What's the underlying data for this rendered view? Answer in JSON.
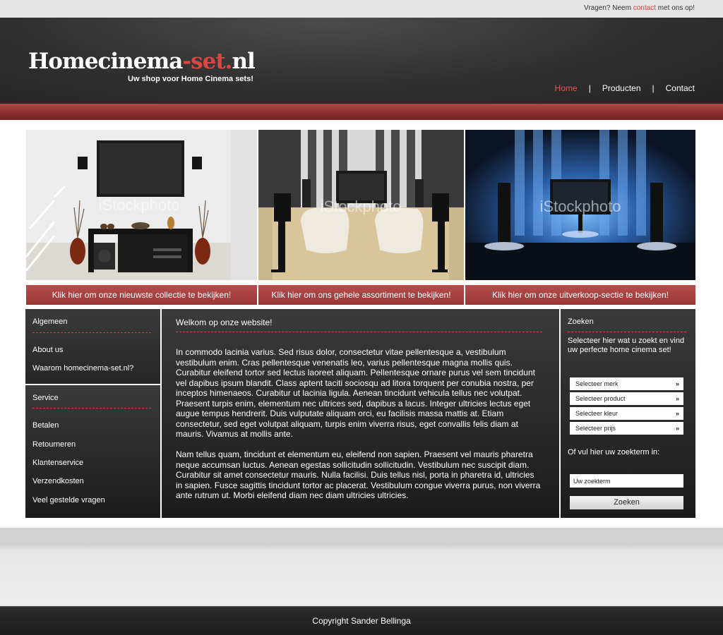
{
  "topbar": {
    "prefix": "Vragen? Neem ",
    "link": "contact",
    "suffix": " met ons op!"
  },
  "header": {
    "logo_part1": "Homecinema",
    "logo_part2": "-set.",
    "logo_part3": "nl",
    "tagline": "Uw shop voor Home Cinema sets!",
    "nav": [
      "Home",
      "Producten",
      "Contact"
    ],
    "nav_separator": "|"
  },
  "banners": [
    {
      "button": "Klik hier om onze nieuwste collectie te bekijken!",
      "watermark": "iStockphoto"
    },
    {
      "button": "Klik hier om ons gehele assortiment te bekijken!",
      "watermark": "iStockphoto"
    },
    {
      "button": "Klik hier om onze uitverkoop-sectie te bekijken!",
      "watermark": "iStockphoto"
    }
  ],
  "sidebar_left": {
    "general_title": "Algemeen",
    "general_links": [
      "About us",
      "Waarom homecinema-set.nl?"
    ],
    "service_title": "Service",
    "service_links": [
      "Betalen",
      "Retourneren",
      "Klantenservice",
      "Verzendkosten",
      "Veel gestelde vragen"
    ]
  },
  "main": {
    "title": "Welkom op onze website!",
    "paragraph1": "In commodo lacinia varius. Sed risus dolor, consectetur vitae pellentesque a, vestibulum vestibulum enim. Cras pellentesque venenatis leo, varius pellentesque magna mollis quis. Curabitur eleifend tortor sed lectus laoreet aliquam. Pellentesque ornare purus vel sem tincidunt vel dapibus ipsum blandit. Class aptent taciti sociosqu ad litora torquent per conubia nostra, per inceptos himenaeos. Curabitur ut lacinia ligula. Aenean tincidunt vehicula tellus nec volutpat. Praesent turpis enim, elementum nec ultrices sed, dapibus a lacus. Integer ultricies lectus eget augue tempus hendrerit. Duis vulputate aliquam orci, eu facilisis massa mattis at. Etiam consectetur, sed eget volutpat aliquam, turpis enim viverra risus, eget convallis felis diam at mauris. Vivamus at mollis ante.",
    "paragraph2": "Nam tellus quam, tincidunt et elementum eu, eleifend non sapien. Praesent vel mauris pharetra neque accumsan luctus. Aenean egestas sollicitudin sollicitudin. Vestibulum nec suscipit diam. Curabitur sit amet consectetur mauris. Nulla facilisi. Duis tellus nisl, porta in pharetra id, ultricies in sapien. Fusce sagittis tincidunt tortor ac placerat. Vestibulum congue viverra purus, non viverra ante rutrum ut. Morbi eleifend diam nec diam ultricies ultricies."
  },
  "sidebar_right": {
    "title": "Zoeken",
    "intro": "Selecteer hier wat u zoekt en vind uw perfecte home cinema set!",
    "selects": [
      "Selecteer merk",
      "Selecteer product",
      "Selecteer kleur",
      "Selecteer prijs"
    ],
    "search_label": "Of vul hier uw zoekterm in:",
    "search_value": "Uw zoekterm",
    "search_button": "Zoeken"
  },
  "footer": {
    "copyright": "Copyright Sander Bellinga"
  },
  "colors": {
    "accent": "#d63f3f",
    "header_bg": "#2e2e2e",
    "red_band": "#8a2e2e"
  }
}
